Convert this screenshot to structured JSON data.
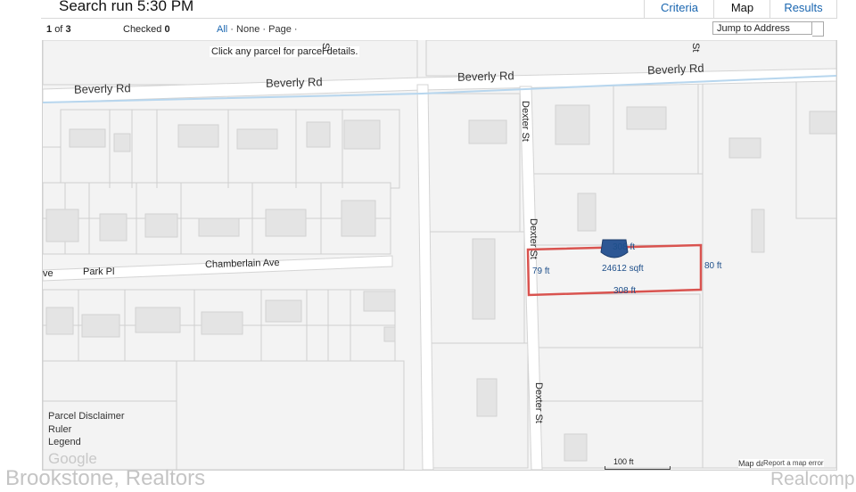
{
  "header": {
    "title": "Search run 5:30 PM",
    "tabs": [
      {
        "label": "Criteria",
        "active": false
      },
      {
        "label": "Map",
        "active": true
      },
      {
        "label": "Results",
        "active": false
      }
    ]
  },
  "toolbar": {
    "position": "1",
    "of_text": "of",
    "total": "3",
    "checked_label": "Checked",
    "checked_count": "0",
    "select_all": "All",
    "select_none": "None",
    "select_page": "Page",
    "separator": "·",
    "jump_placeholder": "Jump to Address"
  },
  "map": {
    "hint": "Click any parcel for parcel details.",
    "streets": {
      "beverly_1": "Beverly Rd",
      "beverly_2": "Beverly Rd",
      "beverly_3": "Beverly Rd",
      "beverly_4": "Beverly Rd",
      "dexter_1": "Dexter St",
      "dexter_2": "Dexter St",
      "dexter_3": "Dexter St",
      "park": "Park Pl",
      "chamberlain": "Chamberlain Ave",
      "ave_fragment": "ve",
      "st_fragment_1": "St",
      "st_fragment_2": "St"
    },
    "parcel": {
      "top": "308 ft",
      "bottom": "308 ft",
      "left": "79 ft",
      "right": "80 ft",
      "area": "24612 sqft",
      "outline_color": "#d9534f"
    },
    "controls": {
      "disclaimer": "Parcel Disclaimer",
      "ruler": "Ruler",
      "legend": "Legend"
    },
    "google": "Google",
    "scale": "100 ft",
    "attribution": "Map data",
    "report": "Report a map error"
  },
  "watermark": {
    "left": "Brookstone, Realtors",
    "right": "Realcomp"
  }
}
